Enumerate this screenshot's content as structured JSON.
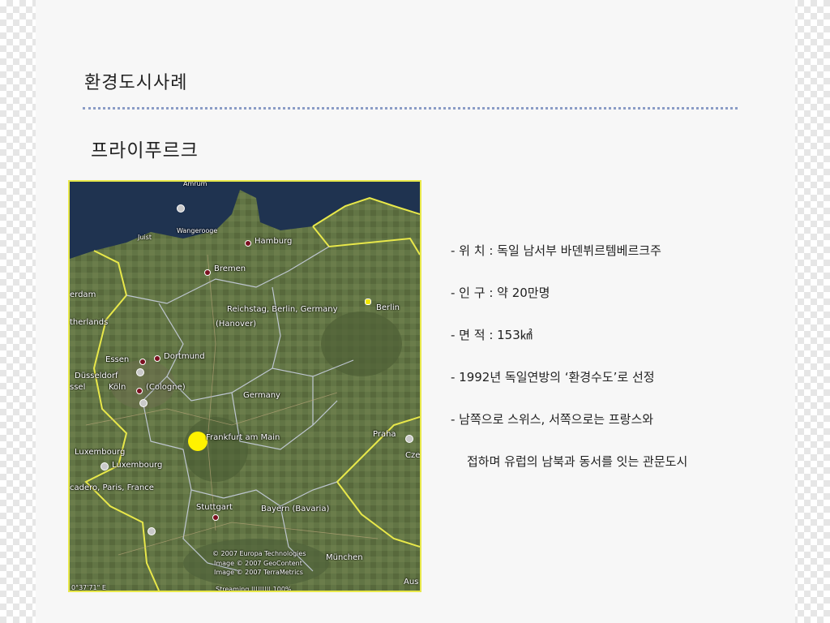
{
  "slide": {
    "title": "환경도시사례",
    "subtitle": "프라이푸르크"
  },
  "map": {
    "labels": {
      "amrum": "Amrum",
      "wangerooge": "Wangerooge",
      "juist": "Juist",
      "hamburg": "Hamburg",
      "bremen": "Bremen",
      "rotterdam": "erdam",
      "netherlands": "therlands",
      "reichstag": "Reichstag, Berlin, Germany",
      "berlin": "Berlin",
      "hanover": "(Hanover)",
      "essen": "Essen",
      "dortmund": "Dortmund",
      "dusseldorf": "Düsseldorf",
      "koln": "Köln",
      "cologne": "(Cologne)",
      "brussel": "ssel",
      "germany": "Germany",
      "frankfurt": "Frankfurt am Main",
      "praha": "Praha",
      "czech": "Cze",
      "luxembourg_region": "Luxembourg",
      "luxembourg_city": "Luxembourg",
      "paris": "cadero, Paris, France",
      "stuttgart": "Stuttgart",
      "bayern": "Bayern (Bavaria)",
      "munchen": "München",
      "austria": "Aus",
      "copyright1": "© 2007 Europa Technologies",
      "copyright2": "Image © 2007 GeoContent",
      "copyright3": "Image © 2007 TerraMetrics",
      "coords": "0°37'71\" E",
      "streaming": "Streaming ||||||||| 100%"
    },
    "colors": {
      "sea": "#1f3350",
      "land": "#5f7243",
      "border": "#e8e84a",
      "marker": "#fff200"
    }
  },
  "info": {
    "lines": [
      "- 위  치 : 독일 남서부 바덴뷔르템베르크주",
      "- 인  구 : 약 20만명",
      "- 면  적 : 153㎢",
      "- 1992년 독일연방의 ‘환경수도’로 선정",
      "- 남쪽으로 스위스, 서쪽으로는 프랑스와",
      "접하며 유럽의 남북과 동서를 잇는 관문도시"
    ]
  }
}
